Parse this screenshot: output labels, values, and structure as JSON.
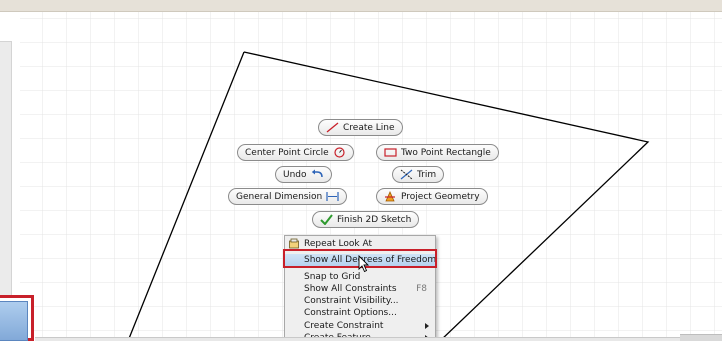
{
  "marking_menu": {
    "create_line": "Create Line",
    "center_point_circle": "Center Point Circle",
    "two_point_rectangle": "Two Point Rectangle",
    "undo": "Undo",
    "trim": "Trim",
    "general_dimension": "General Dimension",
    "project_geometry": "Project Geometry",
    "finish_2d_sketch": "Finish 2D Sketch"
  },
  "context_menu": {
    "items": [
      {
        "label": "Repeat Look At",
        "accelerator": "",
        "submenu": false,
        "icon": "look-at-icon"
      },
      {
        "label": "Show All Degrees of Freedom",
        "accelerator": "",
        "submenu": false,
        "highlighted": true
      },
      {
        "label": "Snap to Grid",
        "accelerator": "",
        "submenu": false
      },
      {
        "label": "Show All Constraints",
        "accelerator": "F8",
        "submenu": false
      },
      {
        "label": "Constraint Visibility...",
        "accelerator": "",
        "submenu": false
      },
      {
        "label": "Constraint Options...",
        "accelerator": "",
        "submenu": false
      },
      {
        "label": "Create Constraint",
        "accelerator": "",
        "submenu": true
      },
      {
        "label": "Create Feature",
        "accelerator": "",
        "submenu": true
      }
    ]
  },
  "colors": {
    "highlight_outline": "#c8202a",
    "menu_highlight": "#b6d2ef",
    "grid": "#e4e4e4",
    "sketch_line": "#000000"
  }
}
